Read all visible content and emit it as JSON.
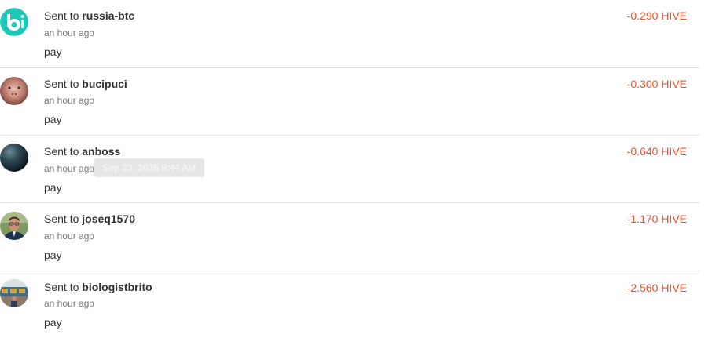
{
  "transactions": [
    {
      "prefix": "Sent to",
      "user": "russia-btc",
      "time": "an hour ago",
      "memo": "pay",
      "amount": "-0.290 HIVE",
      "avatar": "bi-logo-icon"
    },
    {
      "prefix": "Sent to",
      "user": "bucipuci",
      "time": "an hour ago",
      "memo": "pay",
      "amount": "-0.300 HIVE",
      "avatar": "animal-face-photo"
    },
    {
      "prefix": "Sent to",
      "user": "anboss",
      "time": "an hour ago",
      "memo": "pay",
      "amount": "-0.640 HIVE",
      "avatar": "dark-sphere-photo"
    },
    {
      "prefix": "Sent to",
      "user": "joseq1570",
      "time": "an hour ago",
      "memo": "pay",
      "amount": "-1.170 HIVE",
      "avatar": "portrait-photo"
    },
    {
      "prefix": "Sent to",
      "user": "biologistbrito",
      "time": "an hour ago",
      "memo": "pay",
      "amount": "-2.560 HIVE",
      "avatar": "group-photo"
    }
  ],
  "tooltip": {
    "text": "Sep 23, 2025 8:44 AM"
  },
  "colors": {
    "negative_amount": "#e8542c",
    "divider": "#e3e3e3",
    "brand_teal": "#1ec8b9"
  }
}
